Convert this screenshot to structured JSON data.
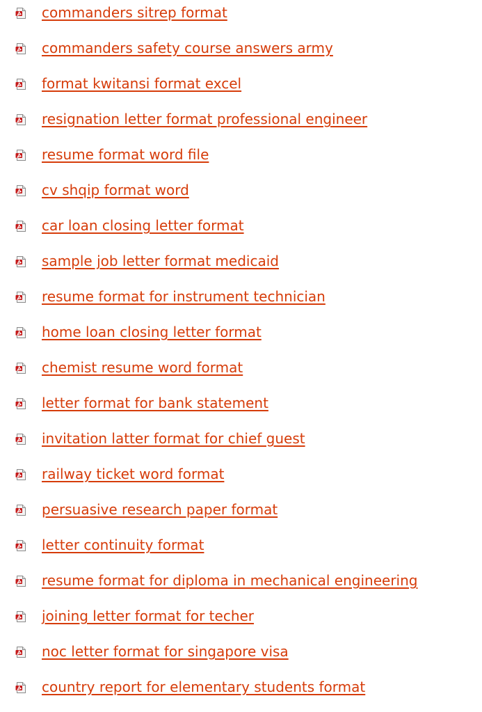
{
  "icon_name": "pdf-file-icon",
  "link_color": "#d63c0a",
  "links": [
    {
      "label": "commanders sitrep format"
    },
    {
      "label": "commanders safety course answers army"
    },
    {
      "label": "format kwitansi format excel"
    },
    {
      "label": "resignation letter format professional engineer"
    },
    {
      "label": "resume format word file"
    },
    {
      "label": "cv shqip format word"
    },
    {
      "label": "car loan closing letter format"
    },
    {
      "label": "sample job letter format medicaid"
    },
    {
      "label": "resume format for instrument technician"
    },
    {
      "label": "home loan closing letter format"
    },
    {
      "label": "chemist resume word format"
    },
    {
      "label": "letter format for bank statement"
    },
    {
      "label": "invitation latter format for chief guest"
    },
    {
      "label": "railway ticket word format"
    },
    {
      "label": "persuasive research paper format"
    },
    {
      "label": "letter continuity format"
    },
    {
      "label": "resume format for diploma in mechanical engineering"
    },
    {
      "label": "joining letter format for techer"
    },
    {
      "label": "noc letter format for singapore visa"
    },
    {
      "label": "country report for elementary students format"
    }
  ]
}
